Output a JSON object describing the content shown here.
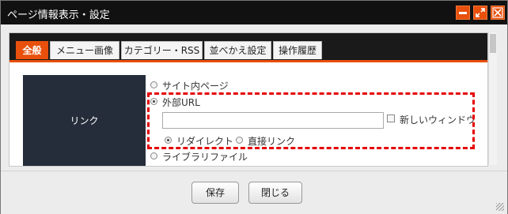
{
  "window": {
    "title": "ページ情報表示・設定"
  },
  "title_buttons": {
    "minimize_icon": "minimize-icon",
    "maximize_icon": "expand-icon",
    "close_icon": "close-icon"
  },
  "tabs": [
    {
      "label": "全般",
      "active": true
    },
    {
      "label": "メニュー画像",
      "active": false
    },
    {
      "label": "カテゴリー・RSS",
      "active": false
    },
    {
      "label": "並べかえ設定",
      "active": false
    },
    {
      "label": "操作履歴",
      "active": false
    }
  ],
  "link_section": {
    "label": "リンク",
    "options": {
      "internal_page": "サイト内ページ",
      "external_url": "外部URL",
      "library_file": "ライブラリファイル"
    },
    "selected": "external_url",
    "url_value": "",
    "new_window_label": "新しいウィンドウ",
    "new_window_checked": false,
    "redirect_label": "リダイレクト",
    "direct_link_label": "直接リンク",
    "link_mode": "redirect"
  },
  "footer": {
    "save_label": "保存",
    "close_label": "閉じる"
  },
  "colors": {
    "accent": "#e8500c",
    "highlight_border": "#e60000",
    "label_bg": "#252d3a"
  }
}
